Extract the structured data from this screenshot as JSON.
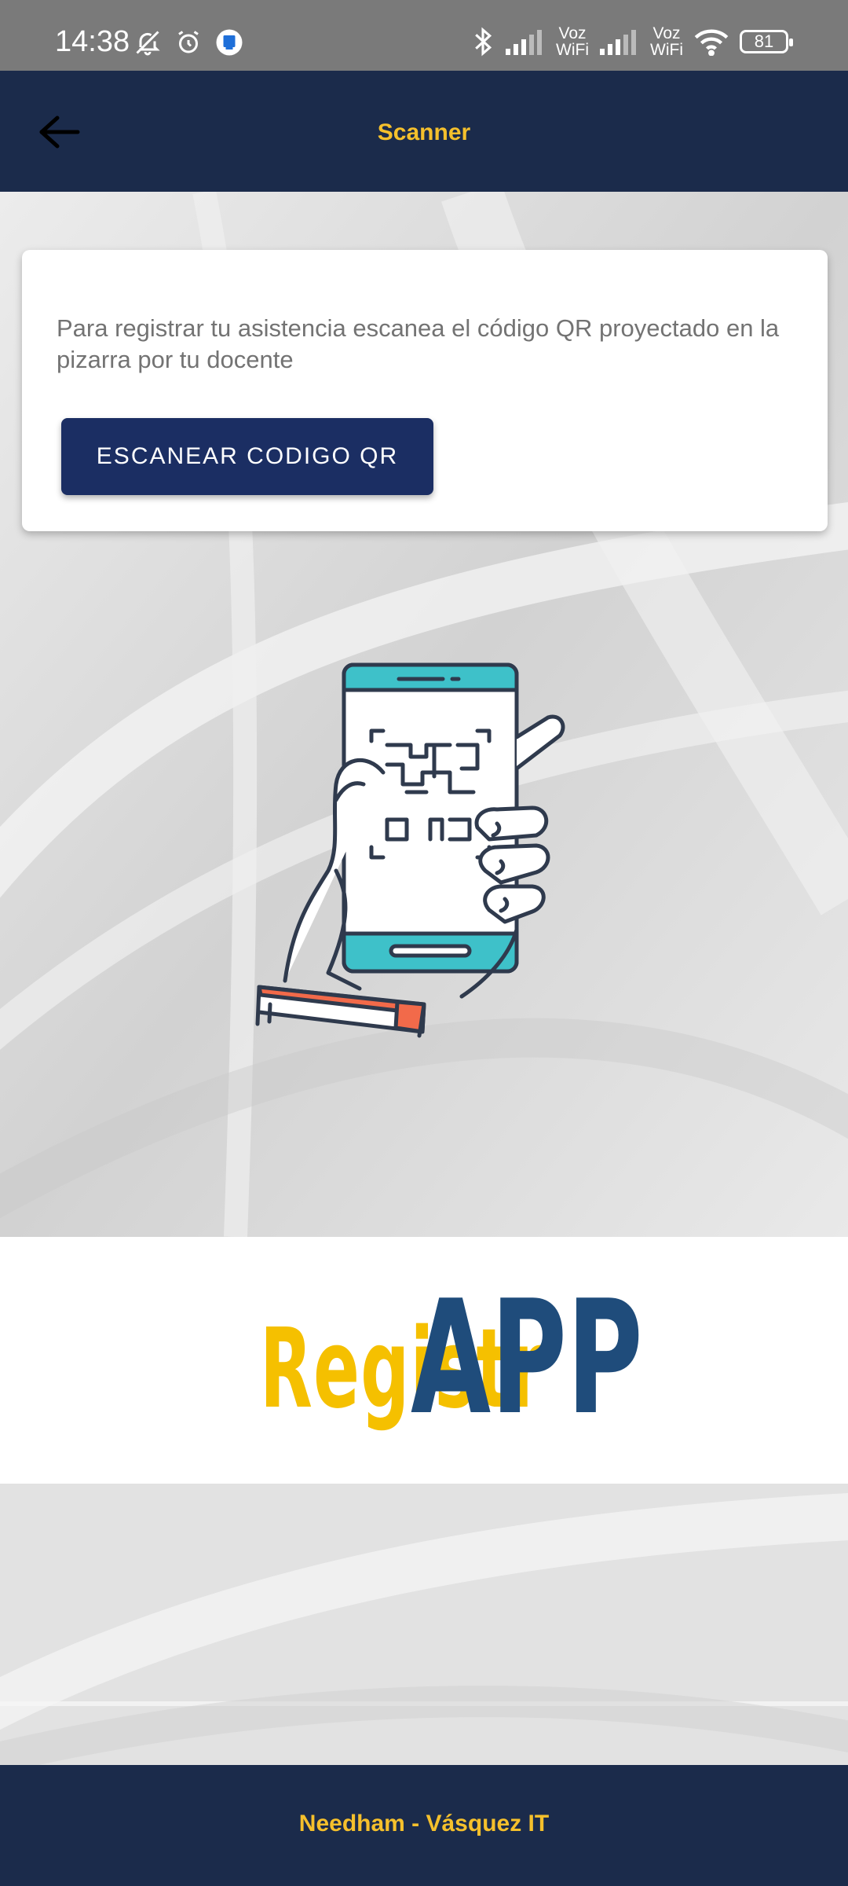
{
  "status_bar": {
    "time": "14:38",
    "voz_wifi_label_1": "Voz\nWiFi",
    "voz_wifi_label_2": "Voz\nWiFi",
    "voz_top": "Voz",
    "wifi_bottom": "WiFi",
    "battery": "81"
  },
  "header": {
    "title": "Scanner",
    "back_icon": "arrow-left-icon"
  },
  "card": {
    "instruction": "Para registrar tu asistencia escanea el código QR proyectado en la pizarra por tu docente",
    "scan_button_label": "ESCANEAR CODIGO QR"
  },
  "logo": {
    "part1": "Registr",
    "part2": "APP"
  },
  "footer": {
    "text": "Needham - Vásquez IT"
  },
  "colors": {
    "header_bg": "#1b2b4b",
    "accent": "#f5c02c",
    "button_bg": "#1b2e63",
    "logo_blue": "#1f4c7b"
  }
}
